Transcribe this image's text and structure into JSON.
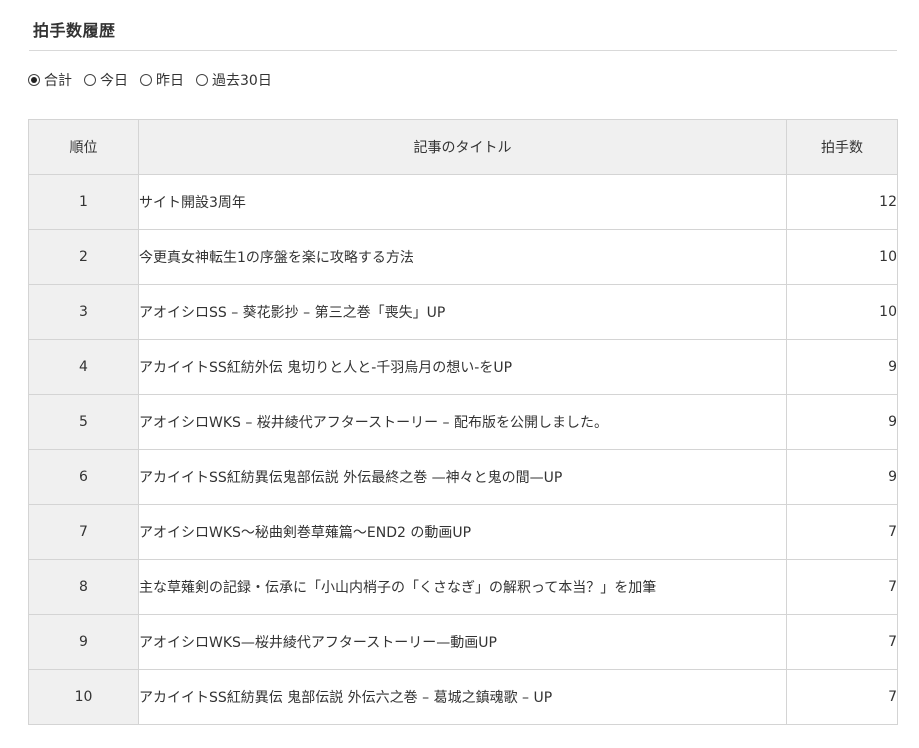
{
  "heading": "拍手数履歴",
  "filters": [
    {
      "label": "合計",
      "checked": true
    },
    {
      "label": "今日",
      "checked": false
    },
    {
      "label": "昨日",
      "checked": false
    },
    {
      "label": "過去30日",
      "checked": false
    }
  ],
  "table": {
    "headers": {
      "rank": "順位",
      "title": "記事のタイトル",
      "count": "拍手数"
    },
    "rows": [
      {
        "rank": "1",
        "title": "サイト開設3周年",
        "count": "12"
      },
      {
        "rank": "2",
        "title": "今更真女神転生1の序盤を楽に攻略する方法",
        "count": "10"
      },
      {
        "rank": "3",
        "title": "アオイシロSS – 葵花影抄 – 第三之巻「喪失」UP",
        "count": "10"
      },
      {
        "rank": "4",
        "title": "アカイイトSS紅紡外伝 鬼切りと人と-千羽烏月の想い-をUP",
        "count": "9"
      },
      {
        "rank": "5",
        "title": "アオイシロWKS – 桜井綾代アフターストーリー – 配布版を公開しました。",
        "count": "9"
      },
      {
        "rank": "6",
        "title": "アカイイトSS紅紡異伝鬼部伝説 外伝最終之巻 —神々と鬼の間—UP",
        "count": "9"
      },
      {
        "rank": "7",
        "title": "アオイシロWKS～秘曲剣巻草薙篇～END2 の動画UP",
        "count": "7"
      },
      {
        "rank": "8",
        "title": "主な草薙剣の記録・伝承に「小山内梢子の「くさなぎ」の解釈って本当？」を加筆",
        "count": "7"
      },
      {
        "rank": "9",
        "title": "アオイシロWKS—桜井綾代アフターストーリー—動画UP",
        "count": "7"
      },
      {
        "rank": "10",
        "title": "アカイイトSS紅紡異伝 鬼部伝説 外伝六之巻 – 葛城之鎮魂歌 – UP",
        "count": "7"
      }
    ]
  }
}
